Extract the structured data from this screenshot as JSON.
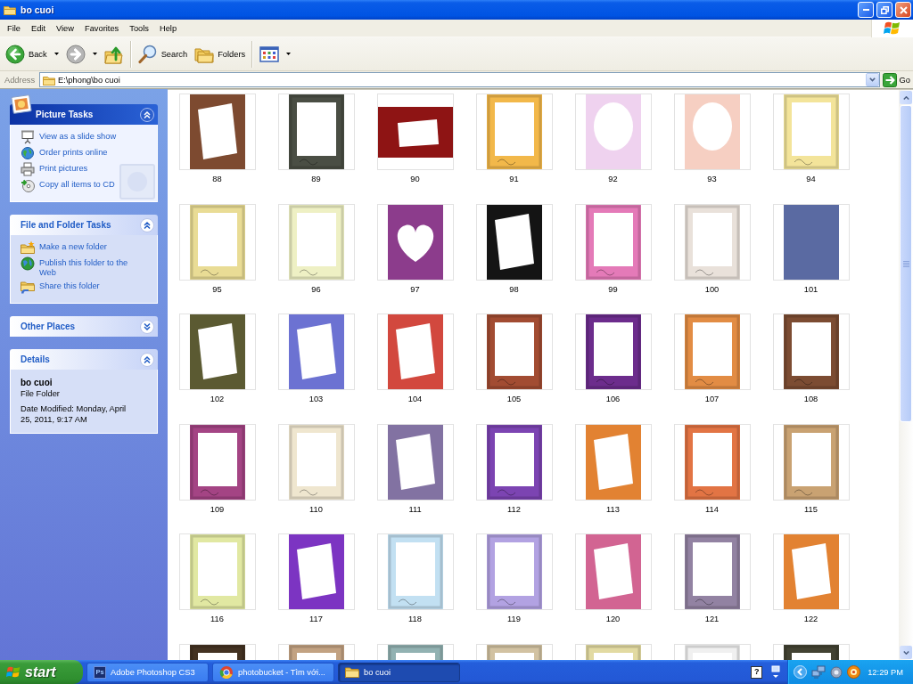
{
  "window": {
    "title": "bo cuoi"
  },
  "menu": [
    "File",
    "Edit",
    "View",
    "Favorites",
    "Tools",
    "Help"
  ],
  "toolbar": {
    "groups": [
      [
        {
          "kind": "back",
          "label": "Back",
          "disabled": false
        },
        {
          "kind": "forward",
          "disabled": true
        },
        {
          "kind": "up",
          "disabled": false
        }
      ],
      [
        {
          "kind": "search",
          "label": "Search",
          "disabled": false
        },
        {
          "kind": "folders",
          "label": "Folders",
          "disabled": false
        }
      ],
      [
        {
          "kind": "views",
          "disabled": false
        }
      ]
    ]
  },
  "address": {
    "label": "Address",
    "value": "E:\\phong\\bo cuoi",
    "go": "Go"
  },
  "task_pane": [
    {
      "title": "Picture Tasks",
      "kind": "special",
      "expanded": true,
      "items": [
        {
          "label": "View as a slide show",
          "kind": "slideshow"
        },
        {
          "label": "Order prints online",
          "kind": "order"
        },
        {
          "label": "Print pictures",
          "kind": "print"
        },
        {
          "label": "Copy all items to CD",
          "kind": "cd"
        }
      ]
    },
    {
      "title": "File and Folder Tasks",
      "kind": "normal",
      "expanded": true,
      "items": [
        {
          "label": "Make a new folder",
          "kind": "new-folder"
        },
        {
          "label": "Publish this folder to the Web",
          "kind": "publish"
        },
        {
          "label": "Share this folder",
          "kind": "share"
        }
      ]
    },
    {
      "title": "Other Places",
      "kind": "normal",
      "expanded": false
    },
    {
      "title": "Details",
      "kind": "details",
      "expanded": true,
      "name": "bo cuoi",
      "type": "File Folder",
      "modified": "Date Modified: Monday, April 25, 2011, 9:17 AM"
    }
  ],
  "files": [
    {
      "name": "88",
      "kind": "tilted",
      "color": "#7d4a30",
      "selected": false
    },
    {
      "name": "89",
      "kind": "frame",
      "color": "#4a4e44",
      "selected": false
    },
    {
      "name": "90",
      "kind": "landscape",
      "color": "#8e1414",
      "selected": false
    },
    {
      "name": "91",
      "kind": "frame",
      "color": "#f2b84a",
      "selected": false
    },
    {
      "name": "92",
      "kind": "oval",
      "color": "#efd2ef",
      "selected": false
    },
    {
      "name": "93",
      "kind": "oval",
      "color": "#f6cfc2",
      "selected": false
    },
    {
      "name": "94",
      "kind": "frame",
      "color": "#f3e49a",
      "selected": false
    },
    {
      "name": "95",
      "kind": "frame",
      "color": "#e9dc95",
      "selected": false
    },
    {
      "name": "96",
      "kind": "frame",
      "color": "#eef0c4",
      "selected": false
    },
    {
      "name": "97",
      "kind": "heart",
      "color": "#8c3c8c",
      "selected": false
    },
    {
      "name": "98",
      "kind": "tilted",
      "color": "#141414",
      "selected": false
    },
    {
      "name": "99",
      "kind": "frame",
      "color": "#e47ab8",
      "selected": false
    },
    {
      "name": "100",
      "kind": "frame",
      "color": "#e9e1da",
      "selected": false
    },
    {
      "name": "101",
      "kind": "photo",
      "color": "#5a6aa2",
      "selected": false
    },
    {
      "name": "102",
      "kind": "tilted",
      "color": "#5b5a32",
      "selected": false
    },
    {
      "name": "103",
      "kind": "tilted",
      "color": "#6c72d2",
      "selected": false
    },
    {
      "name": "104",
      "kind": "tilted",
      "color": "#d2483e",
      "selected": false
    },
    {
      "name": "105",
      "kind": "frame",
      "color": "#a24c32",
      "selected": false
    },
    {
      "name": "106",
      "kind": "frame",
      "color": "#6c2c8c",
      "selected": false
    },
    {
      "name": "107",
      "kind": "frame",
      "color": "#e28c44",
      "selected": false
    },
    {
      "name": "108",
      "kind": "frame",
      "color": "#7c4c32",
      "selected": false
    },
    {
      "name": "109",
      "kind": "frame",
      "color": "#a44484",
      "selected": false
    },
    {
      "name": "110",
      "kind": "frame",
      "color": "#efe6cf",
      "selected": false
    },
    {
      "name": "111",
      "kind": "tilted",
      "color": "#8272a2",
      "selected": false
    },
    {
      "name": "112",
      "kind": "frame",
      "color": "#7c44b2",
      "selected": false
    },
    {
      "name": "113",
      "kind": "tilted",
      "color": "#e28232",
      "selected": false
    },
    {
      "name": "114",
      "kind": "frame",
      "color": "#e27444",
      "selected": false
    },
    {
      "name": "115",
      "kind": "frame",
      "color": "#c9a272",
      "selected": false
    },
    {
      "name": "116",
      "kind": "frame",
      "color": "#e1e8a2",
      "selected": false
    },
    {
      "name": "117",
      "kind": "tilted",
      "color": "#7c34c2",
      "selected": false
    },
    {
      "name": "118",
      "kind": "frame",
      "color": "#c2e0f2",
      "selected": false
    },
    {
      "name": "119",
      "kind": "frame",
      "color": "#b2a2e2",
      "selected": false
    },
    {
      "name": "120",
      "kind": "tilted",
      "color": "#d26492",
      "selected": false
    },
    {
      "name": "121",
      "kind": "frame",
      "color": "#9282a2",
      "selected": false
    },
    {
      "name": "122",
      "kind": "tilted",
      "color": "#e28232",
      "selected": false
    },
    {
      "kind": "frame",
      "color": "#433222",
      "selected": false
    },
    {
      "kind": "frame",
      "color": "#c2a282",
      "selected": false
    },
    {
      "kind": "frame",
      "color": "#92b2b2",
      "selected": false
    },
    {
      "kind": "frame",
      "color": "#d2c2a2",
      "selected": false
    },
    {
      "kind": "frame",
      "color": "#e2daa2",
      "selected": false
    },
    {
      "kind": "frame",
      "color": "#f0f0f0",
      "selected": false
    },
    {
      "kind": "frame",
      "color": "#424232",
      "selected": false
    }
  ],
  "taskbar": {
    "start": "start",
    "buttons": [
      {
        "label": "Adobe Photoshop CS3",
        "kind": "photoshop",
        "icon_text": "Ps",
        "selected": false
      },
      {
        "label": "photobucket - Tìm với...",
        "kind": "browser",
        "selected": false
      },
      {
        "label": "bo cuoi",
        "kind": "folder",
        "selected": true
      }
    ],
    "help": "?",
    "clock": "12:29 PM"
  }
}
